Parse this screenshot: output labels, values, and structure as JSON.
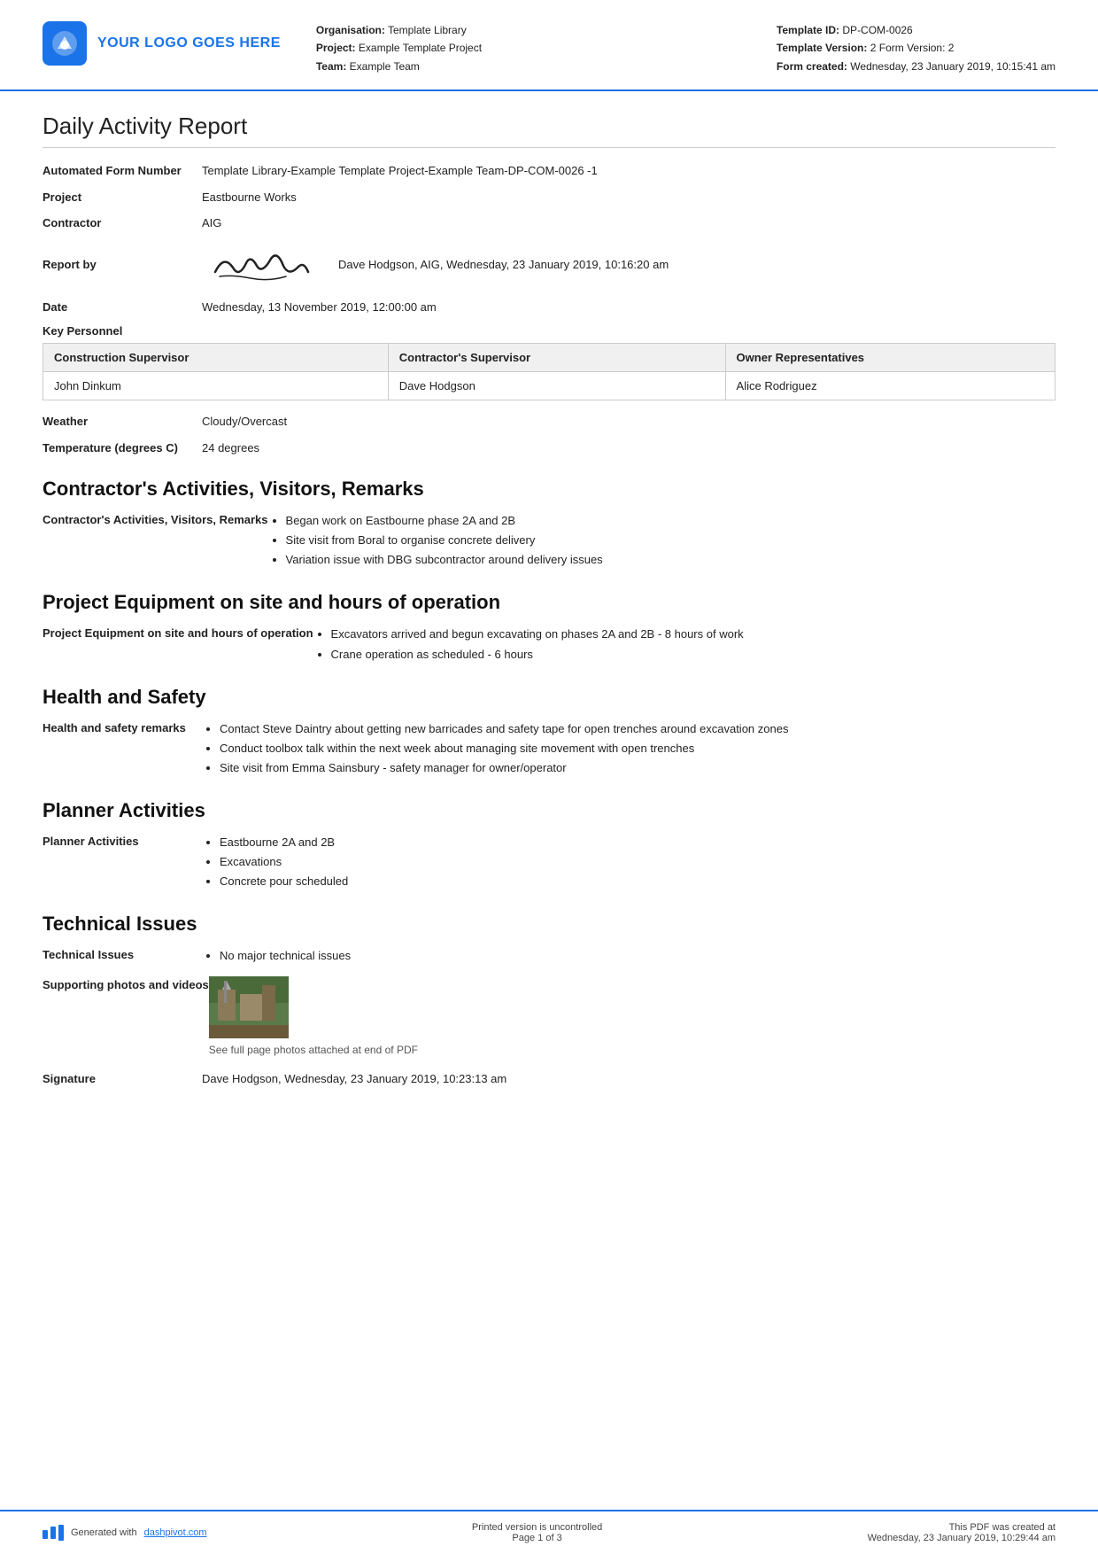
{
  "header": {
    "logo_text": "YOUR LOGO GOES HERE",
    "organisation_label": "Organisation:",
    "organisation_value": "Template Library",
    "project_label": "Project:",
    "project_value": "Example Template Project",
    "team_label": "Team:",
    "team_value": "Example Team",
    "template_id_label": "Template ID:",
    "template_id_value": "DP-COM-0026",
    "template_version_label": "Template Version:",
    "template_version_value": "2 Form Version: 2",
    "form_created_label": "Form created:",
    "form_created_value": "Wednesday, 23 January 2019, 10:15:41 am"
  },
  "report": {
    "title": "Daily Activity Report",
    "automated_form_label": "Automated Form Number",
    "automated_form_value": "Template Library-Example Template Project-Example Team-DP-COM-0026   -1",
    "project_label": "Project",
    "project_value": "Eastbourne Works",
    "contractor_label": "Contractor",
    "contractor_value": "AIG",
    "report_by_label": "Report by",
    "report_by_value": "Dave Hodgson, AIG, Wednesday, 23 January 2019, 10:16:20 am",
    "date_label": "Date",
    "date_value": "Wednesday, 13 November 2019, 12:00:00 am"
  },
  "key_personnel": {
    "label": "Key Personnel",
    "columns": [
      "Construction Supervisor",
      "Contractor's Supervisor",
      "Owner Representatives"
    ],
    "rows": [
      [
        "John Dinkum",
        "Dave Hodgson",
        "Alice Rodriguez"
      ]
    ]
  },
  "weather": {
    "label": "Weather",
    "value": "Cloudy/Overcast"
  },
  "temperature": {
    "label": "Temperature (degrees C)",
    "value": "24 degrees"
  },
  "contractors_activities": {
    "heading": "Contractor's Activities, Visitors, Remarks",
    "field_label": "Contractor's Activities, Visitors, Remarks",
    "items": [
      "Began work on Eastbourne phase 2A and 2B",
      "Site visit from Boral to organise concrete delivery",
      "Variation issue with DBG subcontractor around delivery issues"
    ]
  },
  "project_equipment": {
    "heading": "Project Equipment on site and hours of operation",
    "field_label": "Project Equipment on site and hours of operation",
    "items": [
      "Excavators arrived and begun excavating on phases 2A and 2B - 8 hours of work",
      "Crane operation as scheduled - 6 hours"
    ]
  },
  "health_safety": {
    "heading": "Health and Safety",
    "field_label": "Health and safety remarks",
    "items": [
      "Contact Steve Daintry about getting new barricades and safety tape for open trenches around excavation zones",
      "Conduct toolbox talk within the next week about managing site movement with open trenches",
      "Site visit from Emma Sainsbury - safety manager for owner/operator"
    ]
  },
  "planner_activities": {
    "heading": "Planner Activities",
    "field_label": "Planner Activities",
    "items": [
      "Eastbourne 2A and 2B",
      "Excavations",
      "Concrete pour scheduled"
    ]
  },
  "technical_issues": {
    "heading": "Technical Issues",
    "field_label": "Technical Issues",
    "items": [
      "No major technical issues"
    ],
    "photos_label": "Supporting photos and videos",
    "photos_caption": "See full page photos attached at end of PDF",
    "signature_label": "Signature",
    "signature_value": "Dave Hodgson, Wednesday, 23 January 2019, 10:23:13 am"
  },
  "footer": {
    "generated_text": "Generated with ",
    "link_text": "dashpivot.com",
    "center_text": "Printed version is uncontrolled",
    "page_text": "Page 1 of 3",
    "right_text": "This PDF was created at",
    "right_date": "Wednesday, 23 January 2019, 10:29:44 am"
  }
}
